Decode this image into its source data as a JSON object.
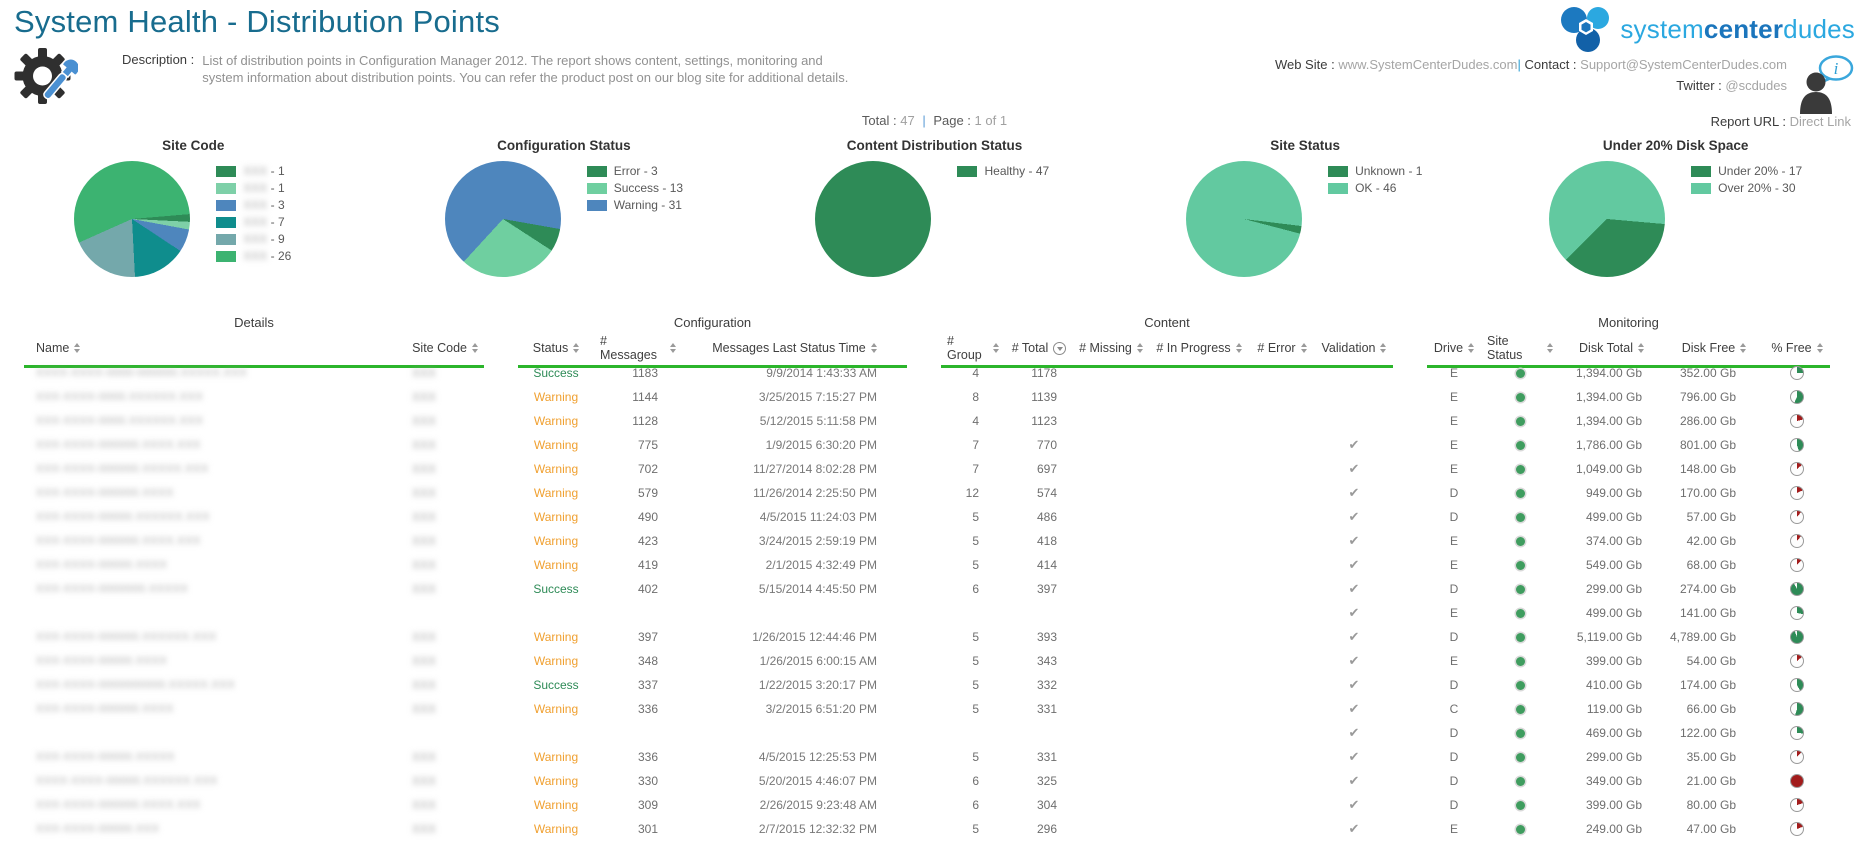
{
  "header": {
    "title": "System Health - Distribution Points",
    "logo_part1": "system",
    "logo_part2": "center",
    "logo_part3": "dudes",
    "description_label": "Description :",
    "description_text": "List of distribution points in Configuration Manager 2012. The report shows content, settings, monitoring and system information about distribution points. You can refer the product post on our blog site for additional details.",
    "website_label": "Web Site :",
    "website_value": "www.SystemCenterDudes.com",
    "separator": "|",
    "contact_label": "Contact :",
    "contact_value": "Support@SystemCenterDudes.com",
    "twitter_label": "Twitter :",
    "twitter_value": "@scdudes",
    "report_url_label": "Report URL :",
    "report_url_value": "Direct Link",
    "total_label": "Total :",
    "total_value": "47",
    "page_label": "Page :",
    "page_value": "1 of 1"
  },
  "colors": {
    "accent_green": "#2bb52b",
    "pie_green": "#2e8b57",
    "pie_red": "#a21c1c",
    "success_text": "#2e8b57",
    "warning_text": "#f0a030"
  },
  "chart_data": [
    {
      "type": "pie",
      "title": "Site Code",
      "start_angle": 246,
      "slices": [
        {
          "label": "site-6",
          "value": 26,
          "color": "#3cb371"
        },
        {
          "label": "site-1",
          "value": 1,
          "color": "#2e8b57"
        },
        {
          "label": "site-2",
          "value": 1,
          "color": "#7ed0a8"
        },
        {
          "label": "site-3",
          "value": 3,
          "color": "#4e86bd"
        },
        {
          "label": "site-4",
          "value": 7,
          "color": "#0f8d8d"
        },
        {
          "label": "site-5",
          "value": 9,
          "color": "#74a8ab"
        }
      ],
      "legend": [
        {
          "label": "XXX",
          "count": "1",
          "color": "#2e8b57",
          "redacted": true
        },
        {
          "label": "XXX",
          "count": "1",
          "color": "#7ed0a8",
          "redacted": true
        },
        {
          "label": "XXX",
          "count": "3",
          "color": "#4e86bd",
          "redacted": true
        },
        {
          "label": "XXX",
          "count": "7",
          "color": "#0f8d8d",
          "redacted": true
        },
        {
          "label": "XXX",
          "count": "9",
          "color": "#74a8ab",
          "redacted": true
        },
        {
          "label": "XXX",
          "count": "26",
          "color": "#3cb371",
          "redacted": true
        }
      ]
    },
    {
      "type": "pie",
      "title": "Configuration Status",
      "start_angle": 100,
      "slices": [
        {
          "label": "Error",
          "value": 3,
          "color": "#2e8b57"
        },
        {
          "label": "Success",
          "value": 13,
          "color": "#6fcfa0"
        },
        {
          "label": "Warning",
          "value": 31,
          "color": "#4e86bd"
        }
      ],
      "legend": [
        {
          "label": "Error",
          "count": "3",
          "color": "#2e8b57"
        },
        {
          "label": "Success",
          "count": "13",
          "color": "#6fcfa0"
        },
        {
          "label": "Warning",
          "count": "31",
          "color": "#4e86bd"
        }
      ]
    },
    {
      "type": "pie",
      "title": "Content Distribution Status",
      "start_angle": 0,
      "slices": [
        {
          "label": "Healthy",
          "value": 47,
          "color": "#2e8b57"
        }
      ],
      "legend": [
        {
          "label": "Healthy",
          "count": "47",
          "color": "#2e8b57"
        }
      ]
    },
    {
      "type": "pie",
      "title": "Site Status",
      "start_angle": 97,
      "slices": [
        {
          "label": "Unknown",
          "value": 1,
          "color": "#2e8b57"
        },
        {
          "label": "OK",
          "value": 46,
          "color": "#62c9a0"
        }
      ],
      "legend": [
        {
          "label": "Unknown",
          "count": "1",
          "color": "#2e8b57"
        },
        {
          "label": "OK",
          "count": "46",
          "color": "#62c9a0"
        }
      ]
    },
    {
      "type": "pie",
      "title": "Under 20% Disk Space",
      "start_angle": 95,
      "slices": [
        {
          "label": "Under 20%",
          "value": 17,
          "color": "#2e8b57"
        },
        {
          "label": "Over 20%",
          "value": 30,
          "color": "#62c9a0"
        }
      ],
      "legend": [
        {
          "label": "Under 20%",
          "count": "17",
          "color": "#2e8b57"
        },
        {
          "label": "Over 20%",
          "count": "30",
          "color": "#62c9a0"
        }
      ]
    }
  ],
  "table": {
    "sections": [
      {
        "label": "Details"
      },
      {
        "label": "Configuration"
      },
      {
        "label": "Content"
      },
      {
        "label": "Monitoring"
      }
    ],
    "columns": [
      {
        "label": "Name"
      },
      {
        "label": "Site Code"
      },
      {
        "label": "Status"
      },
      {
        "label": "# Messages"
      },
      {
        "label": "Messages Last Status Time"
      },
      {
        "label": "# Group"
      },
      {
        "label": "# Total"
      },
      {
        "label": "# Missing"
      },
      {
        "label": "# In Progress"
      },
      {
        "label": "# Error"
      },
      {
        "label": "Validation"
      },
      {
        "label": "Drive"
      },
      {
        "label": "Site Status"
      },
      {
        "label": "Disk Total"
      },
      {
        "label": "Disk Free"
      },
      {
        "label": "% Free"
      }
    ],
    "rows": [
      {
        "name": "XXXX-XXXX-0000-000000.XXXXX.XXX",
        "site": "XXX",
        "status": "Success",
        "messages": "1183",
        "time": "9/9/2014 1:43:33 AM",
        "group": "4",
        "total": "1178",
        "missing": "",
        "inprog": "",
        "error": "",
        "validation": false,
        "drive": "E",
        "dot": true,
        "disktotal": "1,394.00 Gb",
        "diskfree": "352.00 Gb",
        "pct": 25,
        "pcolor": "green"
      },
      {
        "name": "XXX-XXXX-0000.XXXXXX.XXX",
        "site": "XXX",
        "status": "Warning",
        "messages": "1144",
        "time": "3/25/2015 7:15:27 PM",
        "group": "8",
        "total": "1139",
        "missing": "",
        "inprog": "",
        "error": "",
        "validation": false,
        "drive": "E",
        "dot": true,
        "disktotal": "1,394.00 Gb",
        "diskfree": "796.00 Gb",
        "pct": 57,
        "pcolor": "green"
      },
      {
        "name": "XXX-XXXX-0000.XXXXXX.XXX",
        "site": "XXX",
        "status": "Warning",
        "messages": "1128",
        "time": "5/12/2015 5:11:58 PM",
        "group": "4",
        "total": "1123",
        "missing": "",
        "inprog": "",
        "error": "",
        "validation": false,
        "drive": "E",
        "dot": true,
        "disktotal": "1,394.00 Gb",
        "diskfree": "286.00 Gb",
        "pct": 21,
        "pcolor": "red"
      },
      {
        "name": "XXX-XXXX-000000.XXXX.XXX",
        "site": "XXX",
        "status": "Warning",
        "messages": "775",
        "time": "1/9/2015 6:30:20 PM",
        "group": "7",
        "total": "770",
        "missing": "",
        "inprog": "",
        "error": "",
        "validation": true,
        "drive": "E",
        "dot": true,
        "disktotal": "1,786.00 Gb",
        "diskfree": "801.00 Gb",
        "pct": 45,
        "pcolor": "green"
      },
      {
        "name": "XXX-XXXX-000000.XXXXX.XXX",
        "site": "XXX",
        "status": "Warning",
        "messages": "702",
        "time": "11/27/2014 8:02:28 PM",
        "group": "7",
        "total": "697",
        "missing": "",
        "inprog": "",
        "error": "",
        "validation": true,
        "drive": "E",
        "dot": true,
        "disktotal": "1,049.00 Gb",
        "diskfree": "148.00 Gb",
        "pct": 14,
        "pcolor": "red"
      },
      {
        "name": "XXX-XXXX-000000.XXXX",
        "site": "XXX",
        "status": "Warning",
        "messages": "579",
        "time": "11/26/2014 2:25:50 PM",
        "group": "12",
        "total": "574",
        "missing": "",
        "inprog": "",
        "error": "",
        "validation": true,
        "drive": "D",
        "dot": true,
        "disktotal": "949.00 Gb",
        "diskfree": "170.00 Gb",
        "pct": 18,
        "pcolor": "red"
      },
      {
        "name": "XXX-XXXX-00000.XXXXXX.XXX",
        "site": "XXX",
        "status": "Warning",
        "messages": "490",
        "time": "4/5/2015 11:24:03 PM",
        "group": "5",
        "total": "486",
        "missing": "",
        "inprog": "",
        "error": "",
        "validation": true,
        "drive": "D",
        "dot": true,
        "disktotal": "499.00 Gb",
        "diskfree": "57.00 Gb",
        "pct": 11,
        "pcolor": "red"
      },
      {
        "name": "XXX-XXXX-000000.XXXX.XXX",
        "site": "XXX",
        "status": "Warning",
        "messages": "423",
        "time": "3/24/2015 2:59:19 PM",
        "group": "5",
        "total": "418",
        "missing": "",
        "inprog": "",
        "error": "",
        "validation": true,
        "drive": "E",
        "dot": true,
        "disktotal": "374.00 Gb",
        "diskfree": "42.00 Gb",
        "pct": 11,
        "pcolor": "red"
      },
      {
        "name": "XXX-XXXX-00000.XXXX",
        "site": "XXX",
        "status": "Warning",
        "messages": "419",
        "time": "2/1/2015 4:32:49 PM",
        "group": "5",
        "total": "414",
        "missing": "",
        "inprog": "",
        "error": "",
        "validation": true,
        "drive": "E",
        "dot": true,
        "disktotal": "549.00 Gb",
        "diskfree": "68.00 Gb",
        "pct": 12,
        "pcolor": "red"
      },
      {
        "name": "XXX-XXXX-0000000.XXXXX",
        "site": "XXX",
        "status": "Success",
        "messages": "402",
        "time": "5/15/2014 4:45:50 PM",
        "group": "6",
        "total": "397",
        "missing": "",
        "inprog": "",
        "error": "",
        "validation": true,
        "drive": "D",
        "dot": true,
        "disktotal": "299.00 Gb",
        "diskfree": "274.00 Gb",
        "pct": 92,
        "pcolor": "green"
      },
      {
        "name": "",
        "site": "",
        "status": "",
        "messages": "",
        "time": "",
        "group": "",
        "total": "",
        "missing": "",
        "inprog": "",
        "error": "",
        "validation": true,
        "drive": "E",
        "dot": true,
        "disktotal": "499.00 Gb",
        "diskfree": "141.00 Gb",
        "pct": 28,
        "pcolor": "green"
      },
      {
        "name": "XXX-XXXX-000000.XXXXXX.XXX",
        "site": "XXX",
        "status": "Warning",
        "messages": "397",
        "time": "1/26/2015 12:44:46 PM",
        "group": "5",
        "total": "393",
        "missing": "",
        "inprog": "",
        "error": "",
        "validation": true,
        "drive": "D",
        "dot": true,
        "disktotal": "5,119.00 Gb",
        "diskfree": "4,789.00 Gb",
        "pct": 94,
        "pcolor": "green"
      },
      {
        "name": "XXX-XXXX-00000.XXXX",
        "site": "XXX",
        "status": "Warning",
        "messages": "348",
        "time": "1/26/2015 6:00:15 AM",
        "group": "5",
        "total": "343",
        "missing": "",
        "inprog": "",
        "error": "",
        "validation": true,
        "drive": "E",
        "dot": true,
        "disktotal": "399.00 Gb",
        "diskfree": "54.00 Gb",
        "pct": 14,
        "pcolor": "red"
      },
      {
        "name": "XXX-XXXX-0000000000.XXXXX.XXX",
        "site": "XXX",
        "status": "Success",
        "messages": "337",
        "time": "1/22/2015 3:20:17 PM",
        "group": "5",
        "total": "332",
        "missing": "",
        "inprog": "",
        "error": "",
        "validation": true,
        "drive": "D",
        "dot": true,
        "disktotal": "410.00 Gb",
        "diskfree": "174.00 Gb",
        "pct": 42,
        "pcolor": "green"
      },
      {
        "name": "XXX-XXXX-000000.XXXX",
        "site": "XXX",
        "status": "Warning",
        "messages": "336",
        "time": "3/2/2015 6:51:20 PM",
        "group": "5",
        "total": "331",
        "missing": "",
        "inprog": "",
        "error": "",
        "validation": true,
        "drive": "C",
        "dot": true,
        "disktotal": "119.00 Gb",
        "diskfree": "66.00 Gb",
        "pct": 55,
        "pcolor": "green"
      },
      {
        "name": "",
        "site": "",
        "status": "",
        "messages": "",
        "time": "",
        "group": "",
        "total": "",
        "missing": "",
        "inprog": "",
        "error": "",
        "validation": true,
        "drive": "D",
        "dot": true,
        "disktotal": "469.00 Gb",
        "diskfree": "122.00 Gb",
        "pct": 26,
        "pcolor": "green"
      },
      {
        "name": "XXX-XXXX-00000.XXXXX",
        "site": "XXX",
        "status": "Warning",
        "messages": "336",
        "time": "4/5/2015 12:25:53 PM",
        "group": "5",
        "total": "331",
        "missing": "",
        "inprog": "",
        "error": "",
        "validation": true,
        "drive": "D",
        "dot": true,
        "disktotal": "299.00 Gb",
        "diskfree": "35.00 Gb",
        "pct": 12,
        "pcolor": "red"
      },
      {
        "name": "XXXX-XXXX-00000.XXXXXX.XXX",
        "site": "XXX",
        "status": "Warning",
        "messages": "330",
        "time": "5/20/2015 4:46:07 PM",
        "group": "6",
        "total": "325",
        "missing": "",
        "inprog": "",
        "error": "",
        "validation": true,
        "drive": "D",
        "dot": true,
        "disktotal": "349.00 Gb",
        "diskfree": "21.00 Gb",
        "pct": 100,
        "pcolor": "red"
      },
      {
        "name": "XXX-XXXX-000000.XXXX.XXX",
        "site": "XXX",
        "status": "Warning",
        "messages": "309",
        "time": "2/26/2015 9:23:48 AM",
        "group": "6",
        "total": "304",
        "missing": "",
        "inprog": "",
        "error": "",
        "validation": true,
        "drive": "D",
        "dot": true,
        "disktotal": "399.00 Gb",
        "diskfree": "80.00 Gb",
        "pct": 20,
        "pcolor": "red"
      },
      {
        "name": "XXX-XXXX-00000.XXX",
        "site": "XXX",
        "status": "Warning",
        "messages": "301",
        "time": "2/7/2015 12:32:32 PM",
        "group": "5",
        "total": "296",
        "missing": "",
        "inprog": "",
        "error": "",
        "validation": true,
        "drive": "E",
        "dot": true,
        "disktotal": "249.00 Gb",
        "diskfree": "47.00 Gb",
        "pct": 19,
        "pcolor": "red"
      }
    ]
  }
}
